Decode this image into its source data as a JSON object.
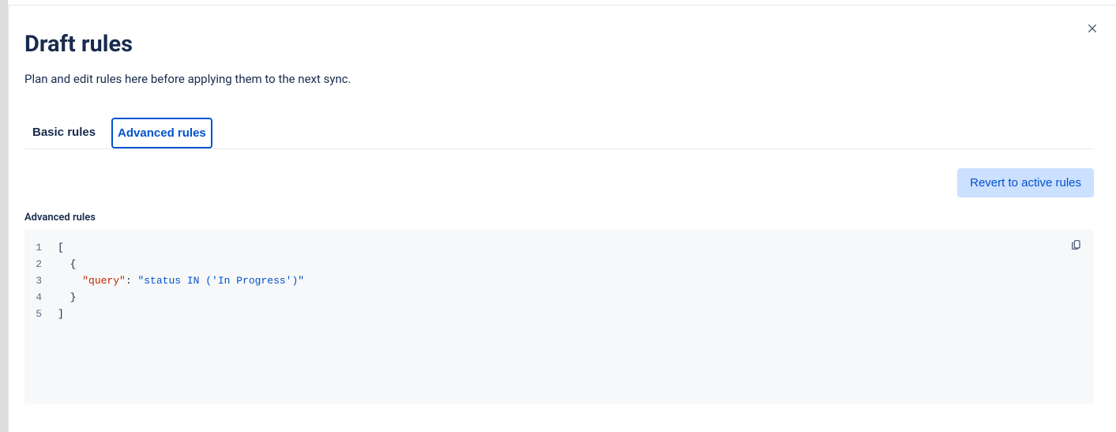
{
  "modal": {
    "title": "Draft rules",
    "subtitle": "Plan and edit rules here before applying them to the next sync."
  },
  "tabs": {
    "basic": "Basic rules",
    "advanced": "Advanced rules",
    "active": "advanced"
  },
  "actions": {
    "revert": "Revert to active rules"
  },
  "editor": {
    "label": "Advanced rules",
    "lines": [
      {
        "num": "1",
        "tokens": [
          {
            "t": "[",
            "c": "punc"
          }
        ],
        "indent": 0
      },
      {
        "num": "2",
        "tokens": [
          {
            "t": "{",
            "c": "punc"
          }
        ],
        "indent": 1
      },
      {
        "num": "3",
        "tokens": [
          {
            "t": "\"query\"",
            "c": "key"
          },
          {
            "t": ": ",
            "c": "punc"
          },
          {
            "t": "\"status IN ('In Progress')\"",
            "c": "str"
          }
        ],
        "indent": 2
      },
      {
        "num": "4",
        "tokens": [
          {
            "t": "}",
            "c": "punc"
          }
        ],
        "indent": 1
      },
      {
        "num": "5",
        "tokens": [
          {
            "t": "]",
            "c": "punc"
          }
        ],
        "indent": 0
      }
    ],
    "value": "[\n  {\n    \"query\": \"status IN ('In Progress')\"\n  }\n]"
  }
}
